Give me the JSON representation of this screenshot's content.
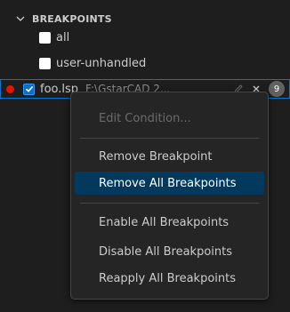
{
  "section": {
    "title": "BREAKPOINTS"
  },
  "breakpoints": {
    "items": [
      {
        "label": "all",
        "checked": false
      },
      {
        "label": "user-unhandled",
        "checked": false
      }
    ],
    "file": {
      "name": "foo.lsp",
      "path": "F:\\GstarCAD 2...",
      "count": "9",
      "checked": true
    }
  },
  "context_menu": {
    "items": [
      {
        "label": "Edit Condition...",
        "enabled": false
      },
      {
        "label": "Remove Breakpoint",
        "enabled": true
      },
      {
        "label": "Remove All Breakpoints",
        "enabled": true,
        "highlighted": true
      },
      {
        "label": "Enable All Breakpoints",
        "enabled": true
      },
      {
        "label": "Disable All Breakpoints",
        "enabled": true
      },
      {
        "label": "Reapply All Breakpoints",
        "enabled": true
      }
    ]
  },
  "colors": {
    "background": "#1e1e1e",
    "accent": "#0078d4",
    "breakpoint": "#e51400",
    "menu_highlight": "#04395e"
  }
}
